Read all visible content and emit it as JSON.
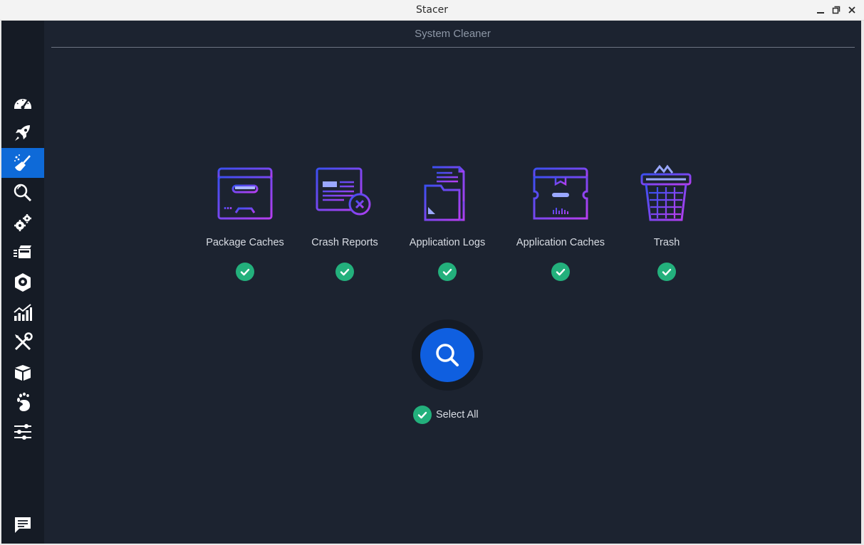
{
  "window": {
    "title": "Stacer"
  },
  "page": {
    "title": "System Cleaner"
  },
  "sidebar": {
    "items": [
      {
        "name": "dashboard",
        "icon": "speedometer-icon",
        "active": false
      },
      {
        "name": "startup-apps",
        "icon": "rocket-icon",
        "active": false
      },
      {
        "name": "system-cleaner",
        "icon": "broom-icon",
        "active": true
      },
      {
        "name": "search",
        "icon": "search-icon",
        "active": false
      },
      {
        "name": "services",
        "icon": "gears-icon",
        "active": false
      },
      {
        "name": "processes",
        "icon": "processes-icon",
        "active": false
      },
      {
        "name": "uninstaller",
        "icon": "disk-icon",
        "active": false
      },
      {
        "name": "resources",
        "icon": "bar-chart-icon",
        "active": false
      },
      {
        "name": "helpers",
        "icon": "tools-icon",
        "active": false
      },
      {
        "name": "apt-repository",
        "icon": "package-icon",
        "active": false
      },
      {
        "name": "gnome-settings",
        "icon": "gnome-foot-icon",
        "active": false
      },
      {
        "name": "settings",
        "icon": "sliders-icon",
        "active": false
      },
      {
        "name": "feedback",
        "icon": "chat-icon",
        "active": false
      }
    ]
  },
  "categories": [
    {
      "label": "Package Caches",
      "icon": "package-caches-icon",
      "checked": true
    },
    {
      "label": "Crash Reports",
      "icon": "crash-reports-icon",
      "checked": true
    },
    {
      "label": "Application Logs",
      "icon": "application-logs-icon",
      "checked": true
    },
    {
      "label": "Application Caches",
      "icon": "application-caches-icon",
      "checked": true
    },
    {
      "label": "Trash",
      "icon": "trash-icon",
      "checked": true
    }
  ],
  "scan": {
    "icon": "search-icon"
  },
  "select_all": {
    "label": "Select All",
    "checked": true
  },
  "colors": {
    "background": "#1c2330",
    "sidebar": "#151b25",
    "active": "#0e6ad8",
    "check": "#23b07c",
    "scan_button": "#0f5fe0",
    "icon_gradient_start": "#3b4ff0",
    "icon_gradient_end": "#b73ef0"
  }
}
